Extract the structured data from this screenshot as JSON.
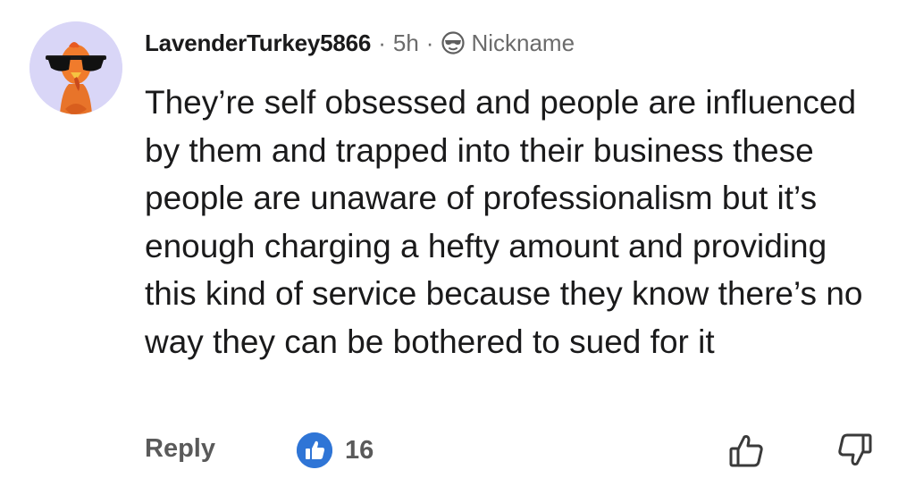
{
  "comment": {
    "author": {
      "username": "LavenderTurkey5866",
      "avatar_icon": "turkey-sunglasses-avatar",
      "avatar_bg": "#d9d6f7"
    },
    "separator": "·",
    "time": "5h",
    "nickname_icon": "sunglasses-icon",
    "nickname": "Nickname",
    "text": "They’re self obsessed and people are influenced by them and trapped into their business these people are unaware of professionalism but it’s enough charging a hefty amount and providing this kind of service because they know there’s no way they can be bothered to sued for it",
    "actions": {
      "reply_label": "Reply",
      "award_icon": "thumbs-up-badge-icon",
      "award_color": "#2f75d6",
      "like_count": "16",
      "upvote_icon": "thumbs-up-icon",
      "downvote_icon": "thumbs-down-icon"
    }
  }
}
